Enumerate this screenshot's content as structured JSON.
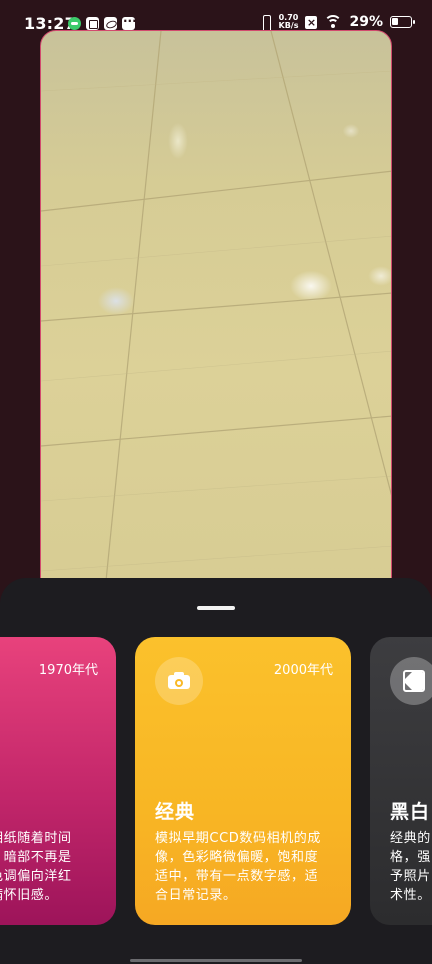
{
  "status_bar": {
    "time": "13:27",
    "net_speed_value": "0.70",
    "net_speed_unit": "KB/s",
    "battery_percent": "29%"
  },
  "film_styles": [
    {
      "era": "1970年代",
      "title": "",
      "description": "相纸随着时间\n，暗部不再是\n色调偏向洋红\n满怀旧感。",
      "accent": "#d62f73"
    },
    {
      "era": "2000年代",
      "title": "经典",
      "description": "模拟早期CCD数码相机的成像，色彩略微偏暖，饱和度适中，带有一点数字感，适合日常记录。",
      "icon": "camera-icon",
      "accent": "#f8b726",
      "selected": true
    },
    {
      "era": "",
      "title": "黑白",
      "description": "经典的\n格，强\n予照片\n术性。",
      "icon": "black-white-icon",
      "accent": "#353537"
    }
  ]
}
